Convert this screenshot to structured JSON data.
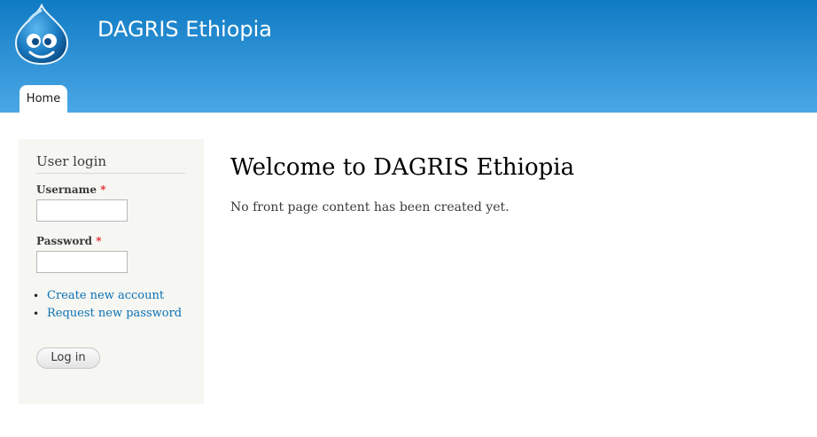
{
  "header": {
    "site_name": "DAGRIS Ethiopia",
    "logo_icon": "drupal-drop-icon",
    "gradient_top": "#0f7bc4",
    "gradient_bottom": "#4aa7e6"
  },
  "nav": {
    "tabs": [
      {
        "label": "Home",
        "active": true
      }
    ]
  },
  "sidebar": {
    "block_title": "User login",
    "username_label": "Username",
    "password_label": "Password",
    "required_marker": "*",
    "username_value": "",
    "password_value": "",
    "links": [
      {
        "label": "Create new account"
      },
      {
        "label": "Request new password"
      }
    ],
    "login_button": "Log in"
  },
  "main": {
    "title": "Welcome to DAGRIS Ethiopia",
    "body": "No front page content has been created yet."
  },
  "colors": {
    "link": "#0b71b4",
    "required": "#e0252b",
    "sidebar_bg": "#f6f6f2"
  }
}
